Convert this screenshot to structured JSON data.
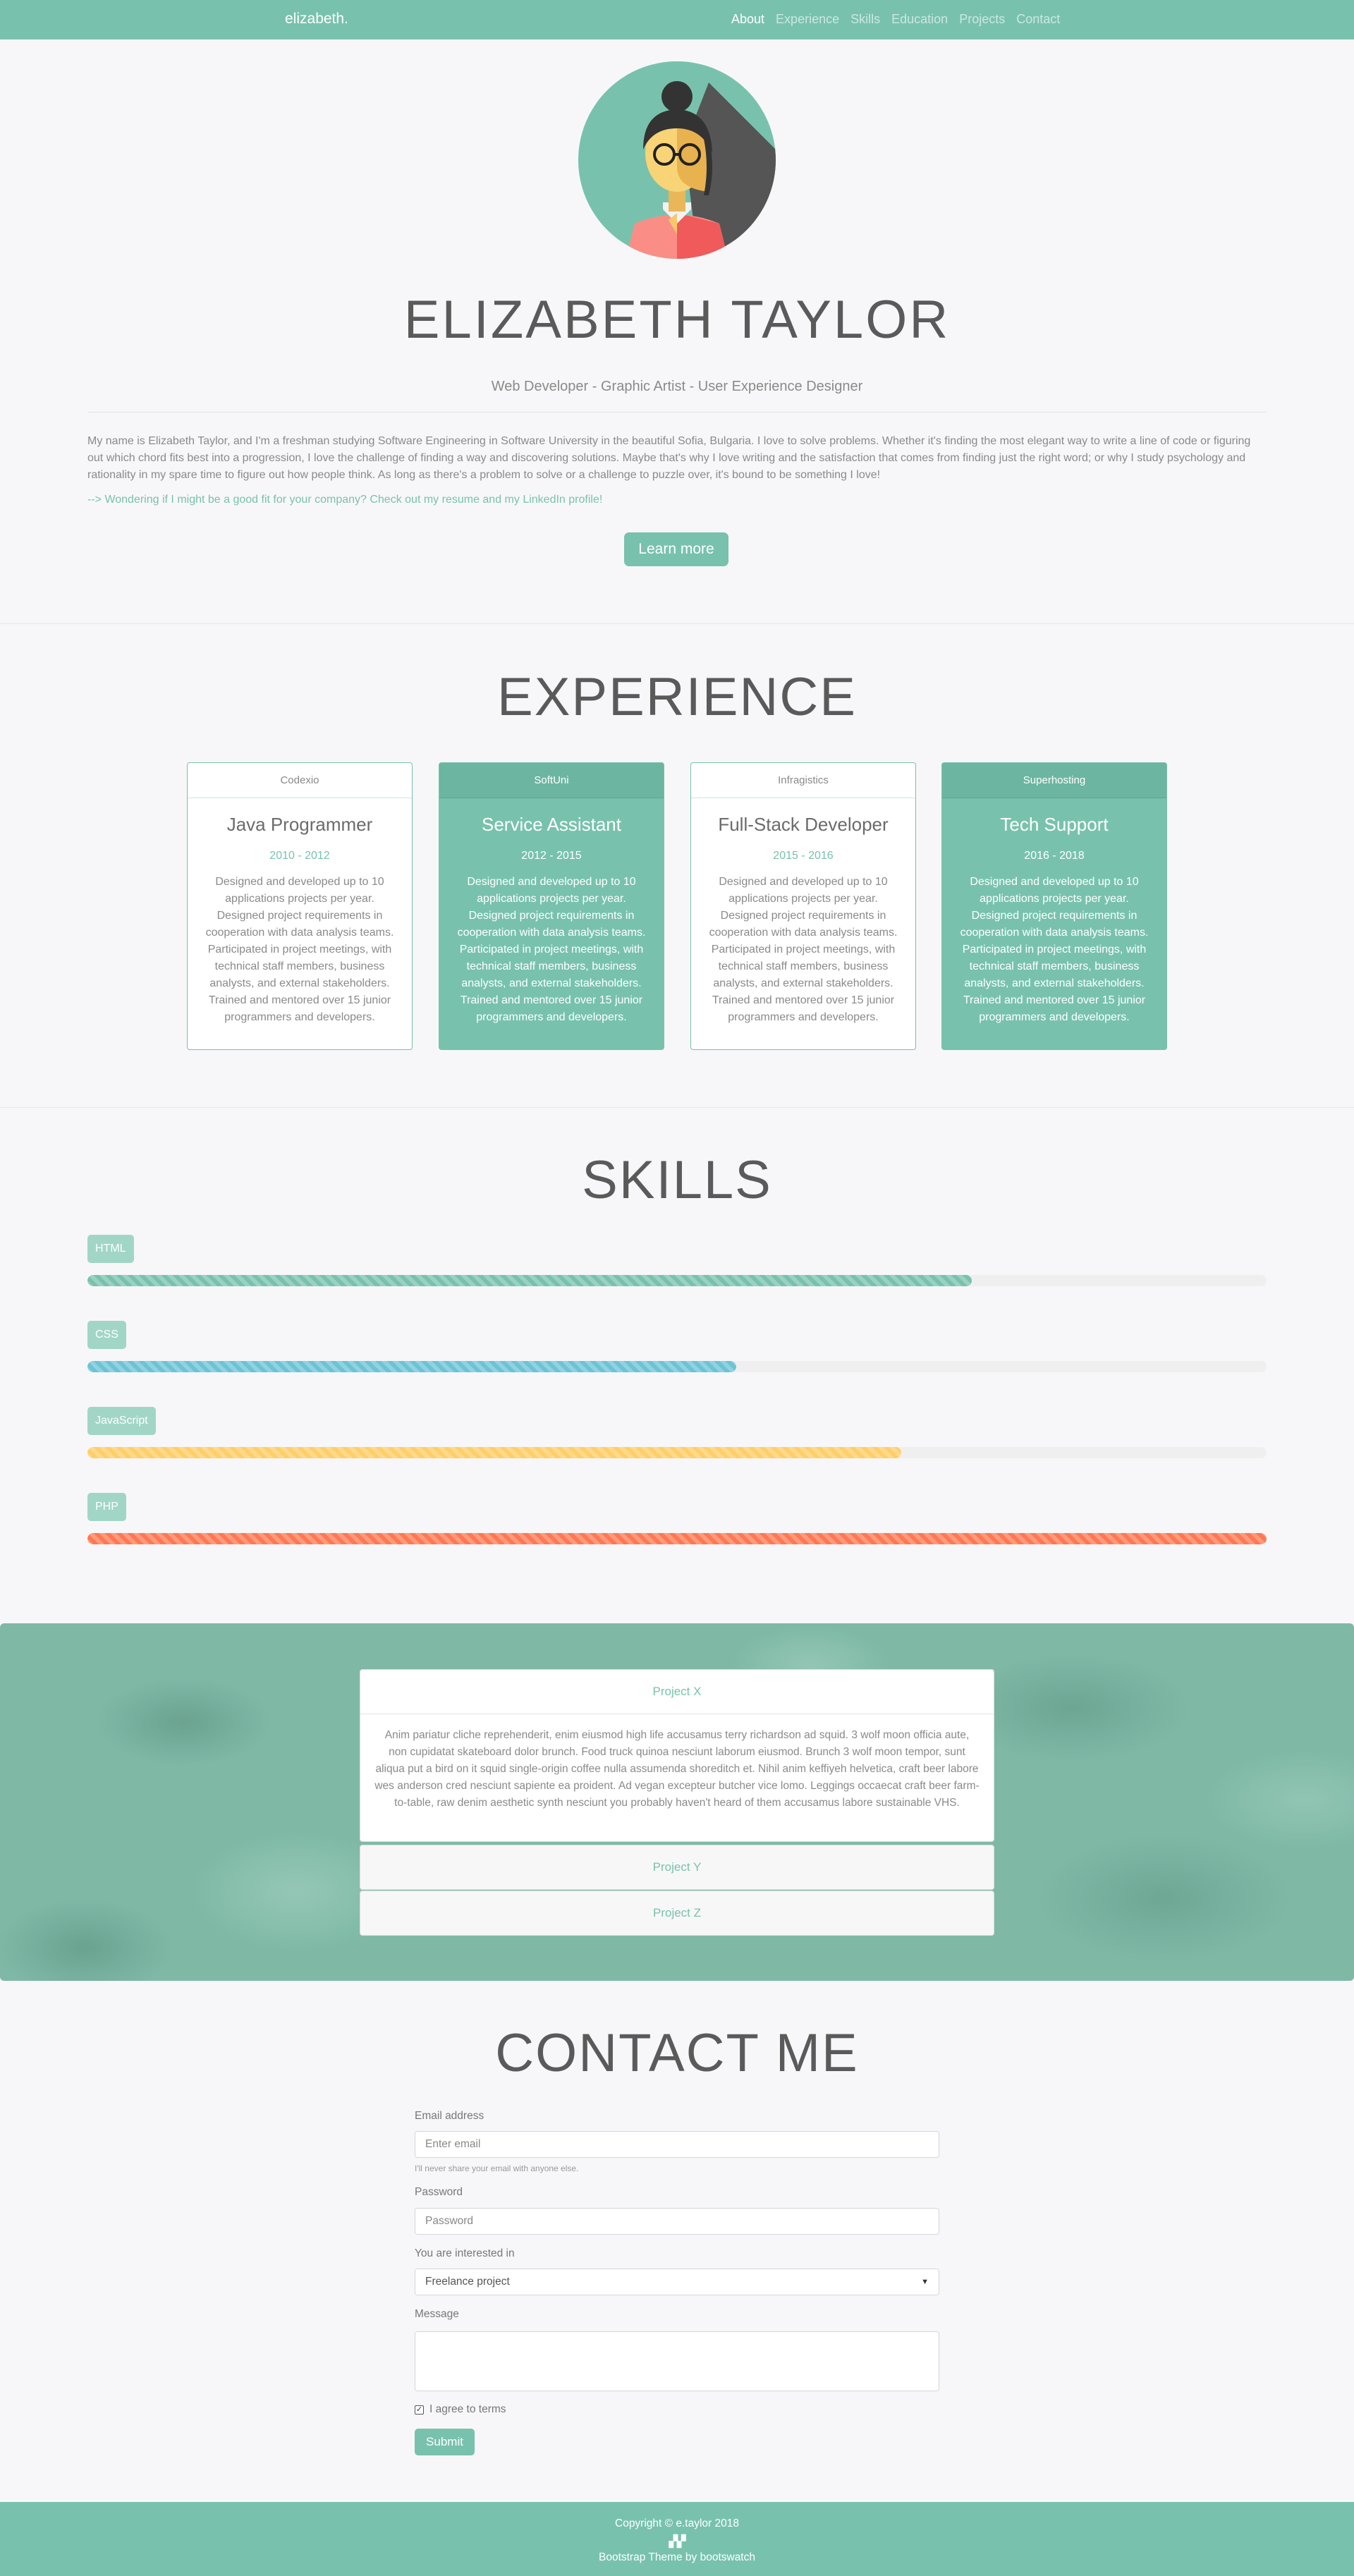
{
  "nav": {
    "brand": "elizabeth.",
    "links": [
      "About",
      "Experience",
      "Skills",
      "Education",
      "Projects",
      "Contact"
    ]
  },
  "hero": {
    "name": "ELIZABETH TAYLOR",
    "subtitle": "Web Developer - Graphic Artist - User Experience Designer",
    "bio": "My name is Elizabeth Taylor, and I'm a freshman studying Software Engineering in Software University in the beautiful Sofia, Bulgaria. I love to solve problems. Whether it's finding the most elegant way to write a line of code or figuring out which chord fits best into a progression, I love the challenge of finding a way and discovering solutions. Maybe that's why I love writing and the satisfaction that comes from finding just the right word; or why I study psychology and rationality in my spare time to figure out how people think. As long as there's a problem to solve or a challenge to puzzle over, it's bound to be something I love!",
    "link": "--> Wondering if I might be a good fit for your company? Check out my resume and my LinkedIn profile!",
    "button": "Learn more"
  },
  "experience": {
    "title": "EXPERIENCE",
    "cards": [
      {
        "company": "Codexio",
        "role": "Java Programmer",
        "years": "2010 - 2012",
        "desc": "Designed and developed up to 10 applications projects per year. Designed project requirements in cooperation with data analysis teams. Participated in project meetings, with technical staff members, business analysts, and external stakeholders. Trained and mentored over 15 junior programmers and developers."
      },
      {
        "company": "SoftUni",
        "role": "Service Assistant",
        "years": "2012 - 2015",
        "desc": "Designed and developed up to 10 applications projects per year. Designed project requirements in cooperation with data analysis teams. Participated in project meetings, with technical staff members, business analysts, and external stakeholders. Trained and mentored over 15 junior programmers and developers."
      },
      {
        "company": "Infragistics",
        "role": "Full-Stack Developer",
        "years": "2015 - 2016",
        "desc": "Designed and developed up to 10 applications projects per year. Designed project requirements in cooperation with data analysis teams. Participated in project meetings, with technical staff members, business analysts, and external stakeholders. Trained and mentored over 15 junior programmers and developers."
      },
      {
        "company": "Superhosting",
        "role": "Tech Support",
        "years": "2016 - 2018",
        "desc": "Designed and developed up to 10 applications projects per year. Designed project requirements in cooperation with data analysis teams. Participated in project meetings, with technical staff members, business analysts, and external stakeholders. Trained and mentored over 15 junior programmers and developers."
      }
    ]
  },
  "skills": {
    "title": "SKILLS",
    "items": [
      {
        "name": "HTML",
        "level": 0.75,
        "color": "#78c2ad"
      },
      {
        "name": "CSS",
        "level": 0.55,
        "color": "#6cc3d5"
      },
      {
        "name": "JavaScript",
        "level": 0.69,
        "color": "#ffce67"
      },
      {
        "name": "PHP",
        "level": 1.0,
        "color": "#ff7851"
      }
    ]
  },
  "projects": {
    "items": [
      {
        "title": "Project X",
        "body": "Anim pariatur cliche reprehenderit, enim eiusmod high life accusamus terry richardson ad squid. 3 wolf moon officia aute, non cupidatat skateboard dolor brunch. Food truck quinoa nesciunt laborum eiusmod. Brunch 3 wolf moon tempor, sunt aliqua put a bird on it squid single-origin coffee nulla assumenda shoreditch et. Nihil anim keffiyeh helvetica, craft beer labore wes anderson cred nesciunt sapiente ea proident. Ad vegan excepteur butcher vice lomo. Leggings occaecat craft beer farm-to-table, raw denim aesthetic synth nesciunt you probably haven't heard of them accusamus labore sustainable VHS."
      },
      {
        "title": "Project Y"
      },
      {
        "title": "Project Z"
      }
    ]
  },
  "contact": {
    "title": "CONTACT ME",
    "email_label": "Email address",
    "email_placeholder": "Enter email",
    "email_help": "I'll never share your email with anyone else.",
    "password_label": "Password",
    "password_placeholder": "Password",
    "interest_label": "You are interested in",
    "interest_value": "Freelance project",
    "message_label": "Message",
    "terms_label": "I agree to terms",
    "submit": "Submit"
  },
  "footer": {
    "copyright": "Copyright © e.taylor 2018",
    "credit": "Bootstrap Theme by bootswatch"
  },
  "colors": {
    "primary": "#78c2ad",
    "background": "#f7f7f9"
  }
}
